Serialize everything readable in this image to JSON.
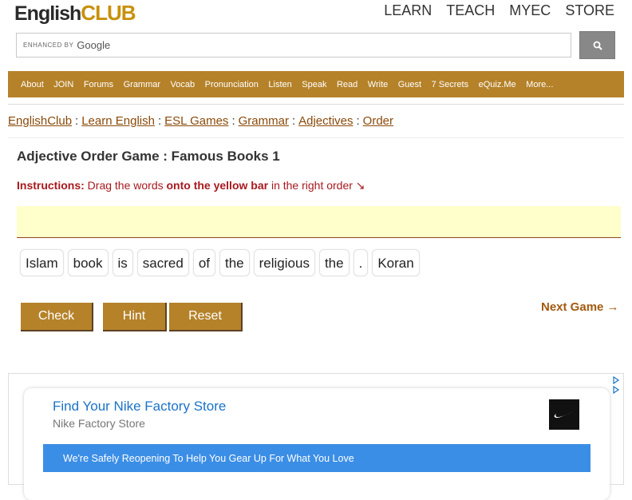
{
  "header": {
    "logo_part1": "English",
    "logo_part2": "CLUB",
    "nav": [
      "LEARN",
      "TEACH",
      "MYEC",
      "STORE"
    ]
  },
  "search": {
    "enhanced_label": "ENHANCED BY",
    "brand": "Google"
  },
  "menu": [
    "About",
    "JOIN",
    "Forums",
    "Grammar",
    "Vocab",
    "Pronunciation",
    "Listen",
    "Speak",
    "Read",
    "Write",
    "Guest",
    "7 Secrets",
    "eQuiz.Me",
    "More..."
  ],
  "breadcrumb": [
    "EnglishClub",
    "Learn English",
    "ESL Games",
    "Grammar",
    "Adjectives",
    "Order"
  ],
  "page": {
    "title": "Adjective Order Game : Famous Books 1",
    "instructions_label": "Instructions:",
    "instructions_text1": " Drag the words ",
    "instructions_strong": "onto the yellow bar",
    "instructions_text2": " in the right order ↘"
  },
  "words": [
    "Islam",
    "book",
    "is",
    "sacred",
    "of",
    "the",
    "religious",
    "the",
    ".",
    "Koran"
  ],
  "buttons": {
    "check": "Check",
    "hint": "Hint",
    "reset": "Reset",
    "next": "Next Game →"
  },
  "ad": {
    "title": "Find Your Nike Factory Store",
    "subtitle": "Nike Factory Store",
    "banner": "We're Safely Reopening To Help You Gear Up For What You Love"
  },
  "colors": {
    "brand_gold": "#b5822a",
    "link_brown": "#8a4a0a",
    "instruction_red": "#a8191e",
    "drop_yellow": "#ffffcc",
    "ad_blue": "#1a73c8"
  }
}
